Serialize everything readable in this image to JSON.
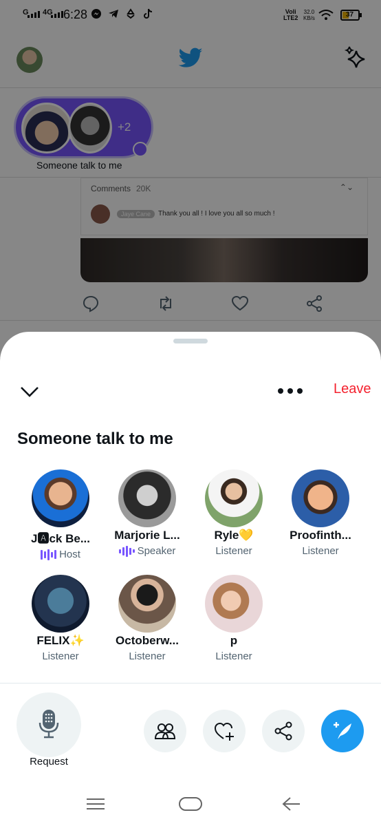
{
  "status_bar": {
    "signal_1": "G",
    "signal_2": "4G",
    "time": "6:28",
    "net_line1": "Voli",
    "net_line2": "LTE2",
    "speed_value": "32.0",
    "speed_unit": "KB/s",
    "battery": "37",
    "icons": [
      "messenger-icon",
      "telegram-icon",
      "sync-icon",
      "tiktok-icon"
    ]
  },
  "background": {
    "app_logo": "twitter-bird-icon",
    "space_card": {
      "extra_count": "+2",
      "label": "Someone talk to me"
    },
    "embedded_comments": {
      "label": "Comments",
      "count": "20K",
      "commenter": "Jaye Cane",
      "comment_text": "Thank you all ! I love you all so much !"
    }
  },
  "sheet": {
    "leave_label": "Leave",
    "title": "Someone talk to me",
    "participants": [
      {
        "name": "J🅰ck Be...",
        "role": "Host"
      },
      {
        "name": "Marjorie L...",
        "role": "Speaker"
      },
      {
        "name": "Ryle💛",
        "role": "Listener"
      },
      {
        "name": "Proofinth...",
        "role": "Listener"
      },
      {
        "name": "FELIX✨",
        "role": "Listener"
      },
      {
        "name": "Octoberw...",
        "role": "Listener"
      },
      {
        "name": "p",
        "role": "Listener"
      }
    ],
    "request_label": "Request"
  },
  "colors": {
    "accent": "#1d9bf0",
    "leave": "#f4212e",
    "space_purple": "#7856ff",
    "muted_text": "#536471"
  }
}
